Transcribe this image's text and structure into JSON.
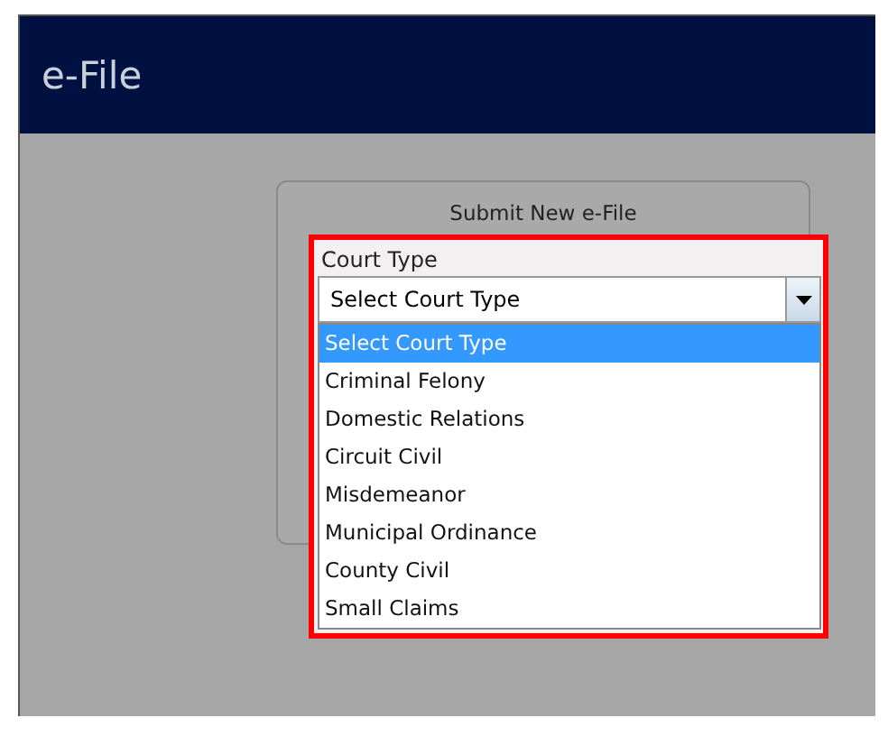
{
  "header": {
    "title": "e-File"
  },
  "card": {
    "title": "Submit New e-File"
  },
  "court_type": {
    "label": "Court Type",
    "value": "Select Court Type",
    "expanded": true,
    "options": [
      {
        "label": "Select Court Type",
        "selected": true
      },
      {
        "label": "Criminal Felony",
        "selected": false
      },
      {
        "label": "Domestic Relations",
        "selected": false
      },
      {
        "label": "Circuit Civil",
        "selected": false
      },
      {
        "label": "Misdemeanor",
        "selected": false
      },
      {
        "label": "Municipal Ordinance",
        "selected": false
      },
      {
        "label": "County Civil",
        "selected": false
      },
      {
        "label": "Small Claims",
        "selected": false
      }
    ]
  }
}
